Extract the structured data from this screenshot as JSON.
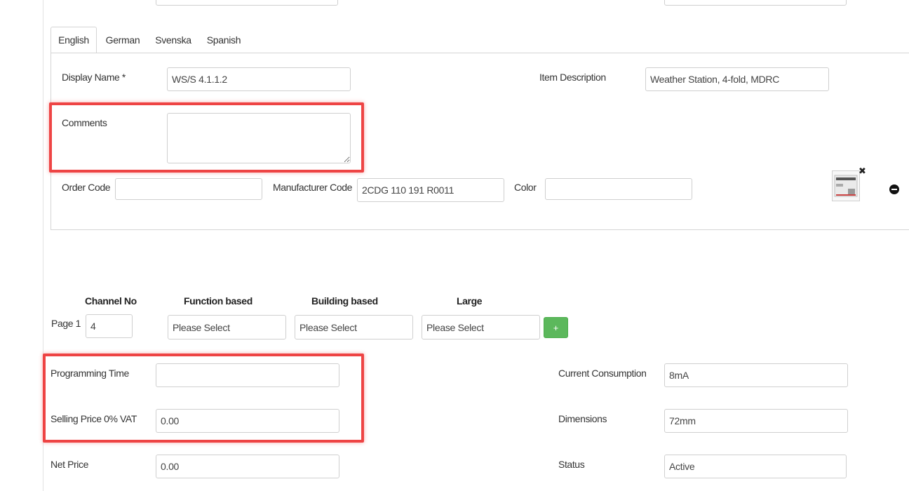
{
  "tabs": [
    "English",
    "German",
    "Svenska",
    "Spanish"
  ],
  "form": {
    "display_name_label": "Display Name *",
    "display_name_value": "WS/S 4.1.1.2",
    "item_description_label": "Item Description",
    "item_description_value": "Weather Station, 4-fold, MDRC",
    "comments_label": "Comments",
    "comments_value": "",
    "order_code_label": "Order Code",
    "order_code_value": "",
    "manufacturer_code_label": "Manufacturer Code",
    "manufacturer_code_value": "2CDG 110 191 R0011",
    "color_label": "Color",
    "color_value": ""
  },
  "channels": {
    "headers": [
      "Channel No",
      "Function based",
      "Building based",
      "Large"
    ],
    "row_label": "Page 1",
    "channel_no": "4",
    "select_placeholder": "Please Select",
    "add_symbol": "+"
  },
  "details": {
    "programming_time_label": "Programming Time",
    "programming_time_value": "",
    "selling_price_label": "Selling Price 0% VAT",
    "selling_price_value": "0.00",
    "net_price_label": "Net Price",
    "net_price_value": "0.00",
    "current_consumption_label": "Current Consumption",
    "current_consumption_value": "8mA",
    "dimensions_label": "Dimensions",
    "dimensions_value": "72mm",
    "status_label": "Status",
    "status_value": "Active"
  },
  "icons": {
    "thumb_close": "✖"
  },
  "colors": {
    "highlight": "#ee4444",
    "add_button": "#5cb85c"
  }
}
